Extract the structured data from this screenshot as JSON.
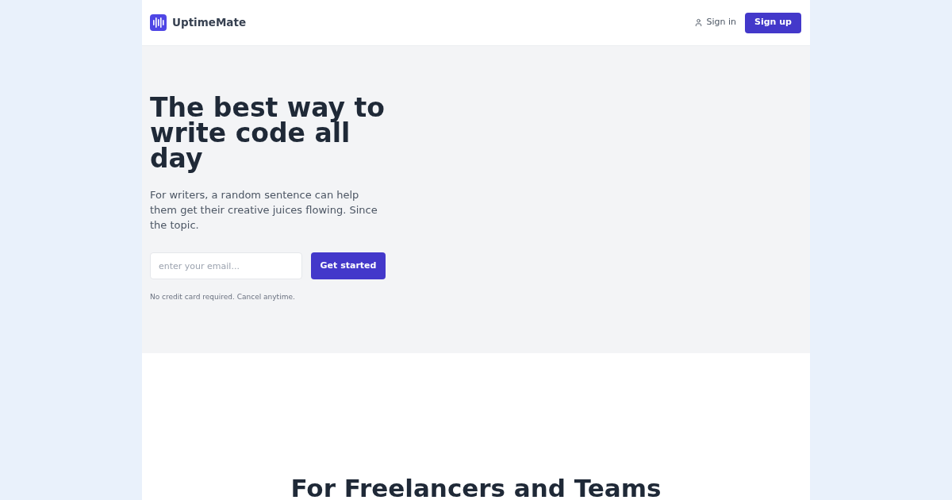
{
  "header": {
    "logo": {
      "name": "UptimeMate"
    },
    "sign_in": "Sign in",
    "sign_up": "Sign up"
  },
  "hero": {
    "title": "The best way to write code all day",
    "description": "For writers, a random sentence can help them get their creative juices flowing. Since the topic.",
    "email_field": {
      "placeholder": "enter your email..."
    },
    "cta_button": "Get started",
    "note": "No credit card required. Cancel anytime."
  },
  "features": {
    "title": "For Freelancers and Teams"
  }
}
